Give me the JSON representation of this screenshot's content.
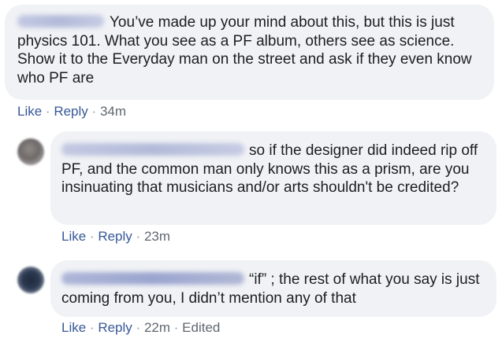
{
  "comments": [
    {
      "text": "You’ve made up your mind about this, but this is just physics 101. What you see as a PF album, others see as science. Show it to the Everyday man on the street and ask if they even know who PF are",
      "like": "Like",
      "reply": "Reply",
      "time": "34m"
    },
    {
      "text": "so if the designer did indeed rip off PF, and the common man only knows this as a prism, are you insinuating that musicians and/or arts shouldn't be credited?",
      "like": "Like",
      "reply": "Reply",
      "time": "23m"
    },
    {
      "text": "“if” ; the rest of what you say is just coming from you, I didn’t mention any of that",
      "like": "Like",
      "reply": "Reply",
      "time": "22m",
      "edited": "Edited"
    }
  ],
  "separator": "·"
}
